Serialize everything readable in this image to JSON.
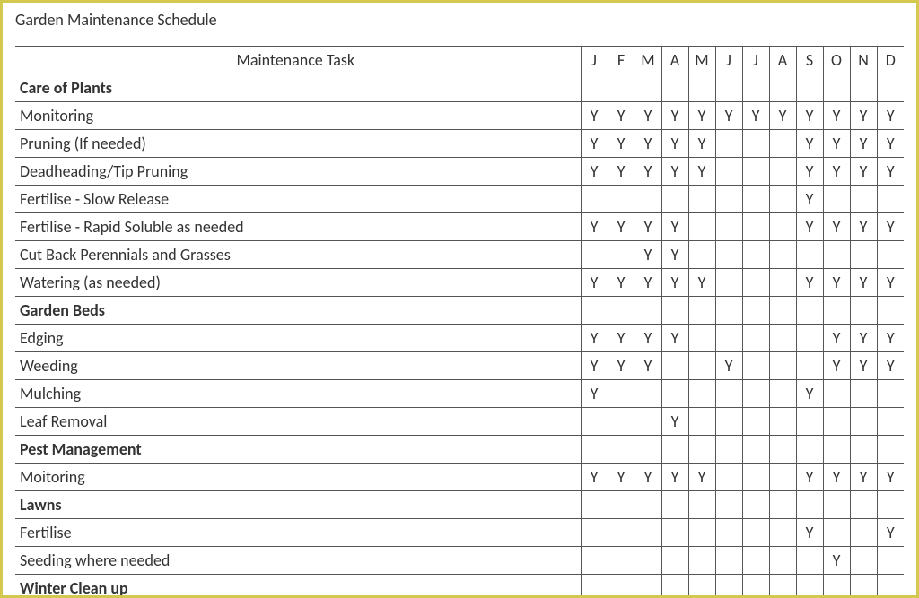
{
  "title": "Garden Maintenance Schedule",
  "header": {
    "task_label": "Maintenance Task",
    "months": [
      "J",
      "F",
      "M",
      "A",
      "M",
      "J",
      "J",
      "A",
      "S",
      "O",
      "N",
      "D"
    ]
  },
  "rows": [
    {
      "type": "section",
      "label": "Care of Plants",
      "cells": [
        "",
        "",
        "",
        "",
        "",
        "",
        "",
        "",
        "",
        "",
        "",
        ""
      ]
    },
    {
      "type": "task",
      "label": "Monitoring",
      "cells": [
        "Y",
        "Y",
        "Y",
        "Y",
        "Y",
        "Y",
        "Y",
        "Y",
        "Y",
        "Y",
        "Y",
        "Y"
      ]
    },
    {
      "type": "task",
      "label": "Pruning (If needed)",
      "cells": [
        "Y",
        "Y",
        "Y",
        "Y",
        "Y",
        "",
        "",
        "",
        "Y",
        "Y",
        "Y",
        "Y"
      ]
    },
    {
      "type": "task",
      "label": "Deadheading/Tip Pruning",
      "cells": [
        "Y",
        "Y",
        "Y",
        "Y",
        "Y",
        "",
        "",
        "",
        "Y",
        "Y",
        "Y",
        "Y"
      ]
    },
    {
      "type": "task",
      "label": "Fertilise - Slow Release",
      "cells": [
        "",
        "",
        "",
        "",
        "",
        "",
        "",
        "",
        "Y",
        "",
        "",
        ""
      ]
    },
    {
      "type": "task",
      "label": "Fertilise - Rapid Soluble as needed",
      "cells": [
        "Y",
        "Y",
        "Y",
        "Y",
        "",
        "",
        "",
        "",
        "Y",
        "Y",
        "Y",
        "Y"
      ]
    },
    {
      "type": "task",
      "label": "Cut Back Perennials and Grasses",
      "cells": [
        "",
        "",
        "Y",
        "Y",
        "",
        "",
        "",
        "",
        "",
        "",
        "",
        ""
      ]
    },
    {
      "type": "task",
      "label": "Watering (as needed)",
      "cells": [
        "Y",
        "Y",
        "Y",
        "Y",
        "Y",
        "",
        "",
        "",
        "Y",
        "Y",
        "Y",
        "Y"
      ]
    },
    {
      "type": "section",
      "label": "Garden Beds",
      "cells": [
        "",
        "",
        "",
        "",
        "",
        "",
        "",
        "",
        "",
        "",
        "",
        ""
      ]
    },
    {
      "type": "task",
      "label": "Edging",
      "cells": [
        "Y",
        "Y",
        "Y",
        "Y",
        "",
        "",
        "",
        "",
        "",
        "Y",
        "Y",
        "Y"
      ]
    },
    {
      "type": "task",
      "label": "Weeding",
      "cells": [
        "Y",
        "Y",
        "Y",
        "",
        "",
        "Y",
        "",
        "",
        "",
        "Y",
        "Y",
        "Y"
      ]
    },
    {
      "type": "task",
      "label": "Mulching",
      "cells": [
        "Y",
        "",
        "",
        "",
        "",
        "",
        "",
        "",
        "Y",
        "",
        "",
        ""
      ]
    },
    {
      "type": "task",
      "label": "Leaf Removal",
      "cells": [
        "",
        "",
        "",
        "Y",
        "",
        "",
        "",
        "",
        "",
        "",
        "",
        ""
      ]
    },
    {
      "type": "section",
      "label": "Pest Management",
      "cells": [
        "",
        "",
        "",
        "",
        "",
        "",
        "",
        "",
        "",
        "",
        "",
        ""
      ]
    },
    {
      "type": "task",
      "label": "Moitoring",
      "cells": [
        "Y",
        "Y",
        "Y",
        "Y",
        "Y",
        "",
        "",
        "",
        "Y",
        "Y",
        "Y",
        "Y"
      ]
    },
    {
      "type": "section",
      "label": "Lawns",
      "cells": [
        "",
        "",
        "",
        "",
        "",
        "",
        "",
        "",
        "",
        "",
        "",
        ""
      ]
    },
    {
      "type": "task",
      "label": "Fertilise",
      "cells": [
        "",
        "",
        "",
        "",
        "",
        "",
        "",
        "",
        "Y",
        "",
        "",
        "Y"
      ]
    },
    {
      "type": "task",
      "label": "Seeding where needed",
      "cells": [
        "",
        "",
        "",
        "",
        "",
        "",
        "",
        "",
        "",
        "Y",
        "",
        ""
      ]
    },
    {
      "type": "section",
      "label": "Winter Clean up",
      "cells": [
        "",
        "",
        "",
        "",
        "",
        "",
        "",
        "",
        "",
        "",
        "",
        ""
      ]
    }
  ]
}
